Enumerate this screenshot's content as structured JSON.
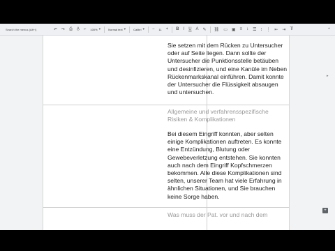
{
  "toolbar": {
    "search_text": "Search the menus (Alt+/)",
    "zoom": "100%",
    "style": "Normal text",
    "font": "Calibri",
    "font_size": "11",
    "bold": "B",
    "italic": "I",
    "underline": "U",
    "text_color": "A"
  },
  "document": {
    "cell1_text": "Sie setzen mit dem Rücken zu Untersucher oder auf Seite liegen. Dann sollte der Untersucher die Punktionsstelle betäuben und desinfizieren, und eine Kanüle im Neben Rückenmarkskanal einführen. Damit konnte der Untersucher die Flüssigkeit absaugen und untersuchen.",
    "cell2_heading": "Allgemeine und verfahrensspezifische Risiken & Komplikationen",
    "cell2_text": "Bei diesem Eingriff konnten, aber selten einige Komplikationen auftreten. Es konnte eine Entzündung,  Blutung oder Gewebeverletzung entstehen. Sie konnten auch nach dem Eingriff Kopfschmerzen bekommen. Alle diese Komplikationen sind selten, unserer Team hat viele Erfahrung in ähnlichen Situationen, und Sie brauchen keine Sorge haben.",
    "cell3_heading": "Was muss der Pat. vor und nach dem"
  }
}
